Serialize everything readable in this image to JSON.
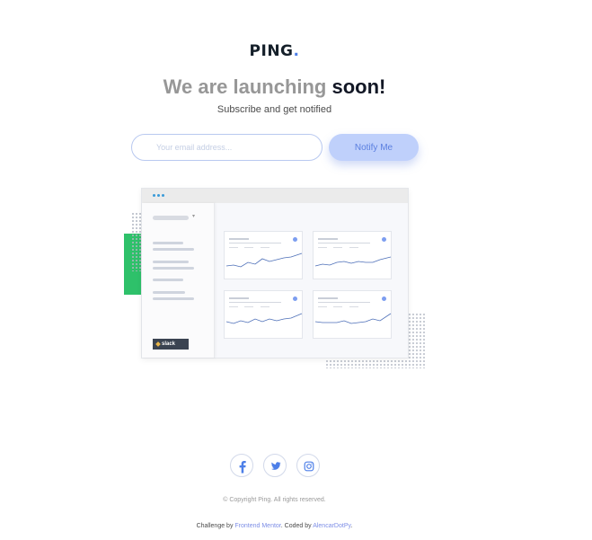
{
  "brand": {
    "name": "PING",
    "dot": "."
  },
  "hero": {
    "headline_prefix": "We are launching ",
    "headline_strong": "soon!",
    "subline": "Subscribe and get notified"
  },
  "form": {
    "email_placeholder": "Your email address...",
    "email_value": "",
    "submit_label": "Notify Me"
  },
  "illustration": {
    "slack_label": "slack"
  },
  "social": {
    "items": [
      {
        "icon": "facebook-icon"
      },
      {
        "icon": "twitter-icon"
      },
      {
        "icon": "instagram-icon"
      }
    ]
  },
  "footer": {
    "copyright": "© Copyright Ping. All rights reserved.",
    "challenge_prefix": "Challenge by ",
    "challenge_link": "Frontend Mentor",
    "coded_prefix": ". Coded by ",
    "coder_link": "AlencarDotPy",
    "suffix": "."
  },
  "colors": {
    "accent": "#4d7fe8",
    "button_bg": "#bfd0fb",
    "green": "#2ec16a",
    "dark": "#121725"
  }
}
